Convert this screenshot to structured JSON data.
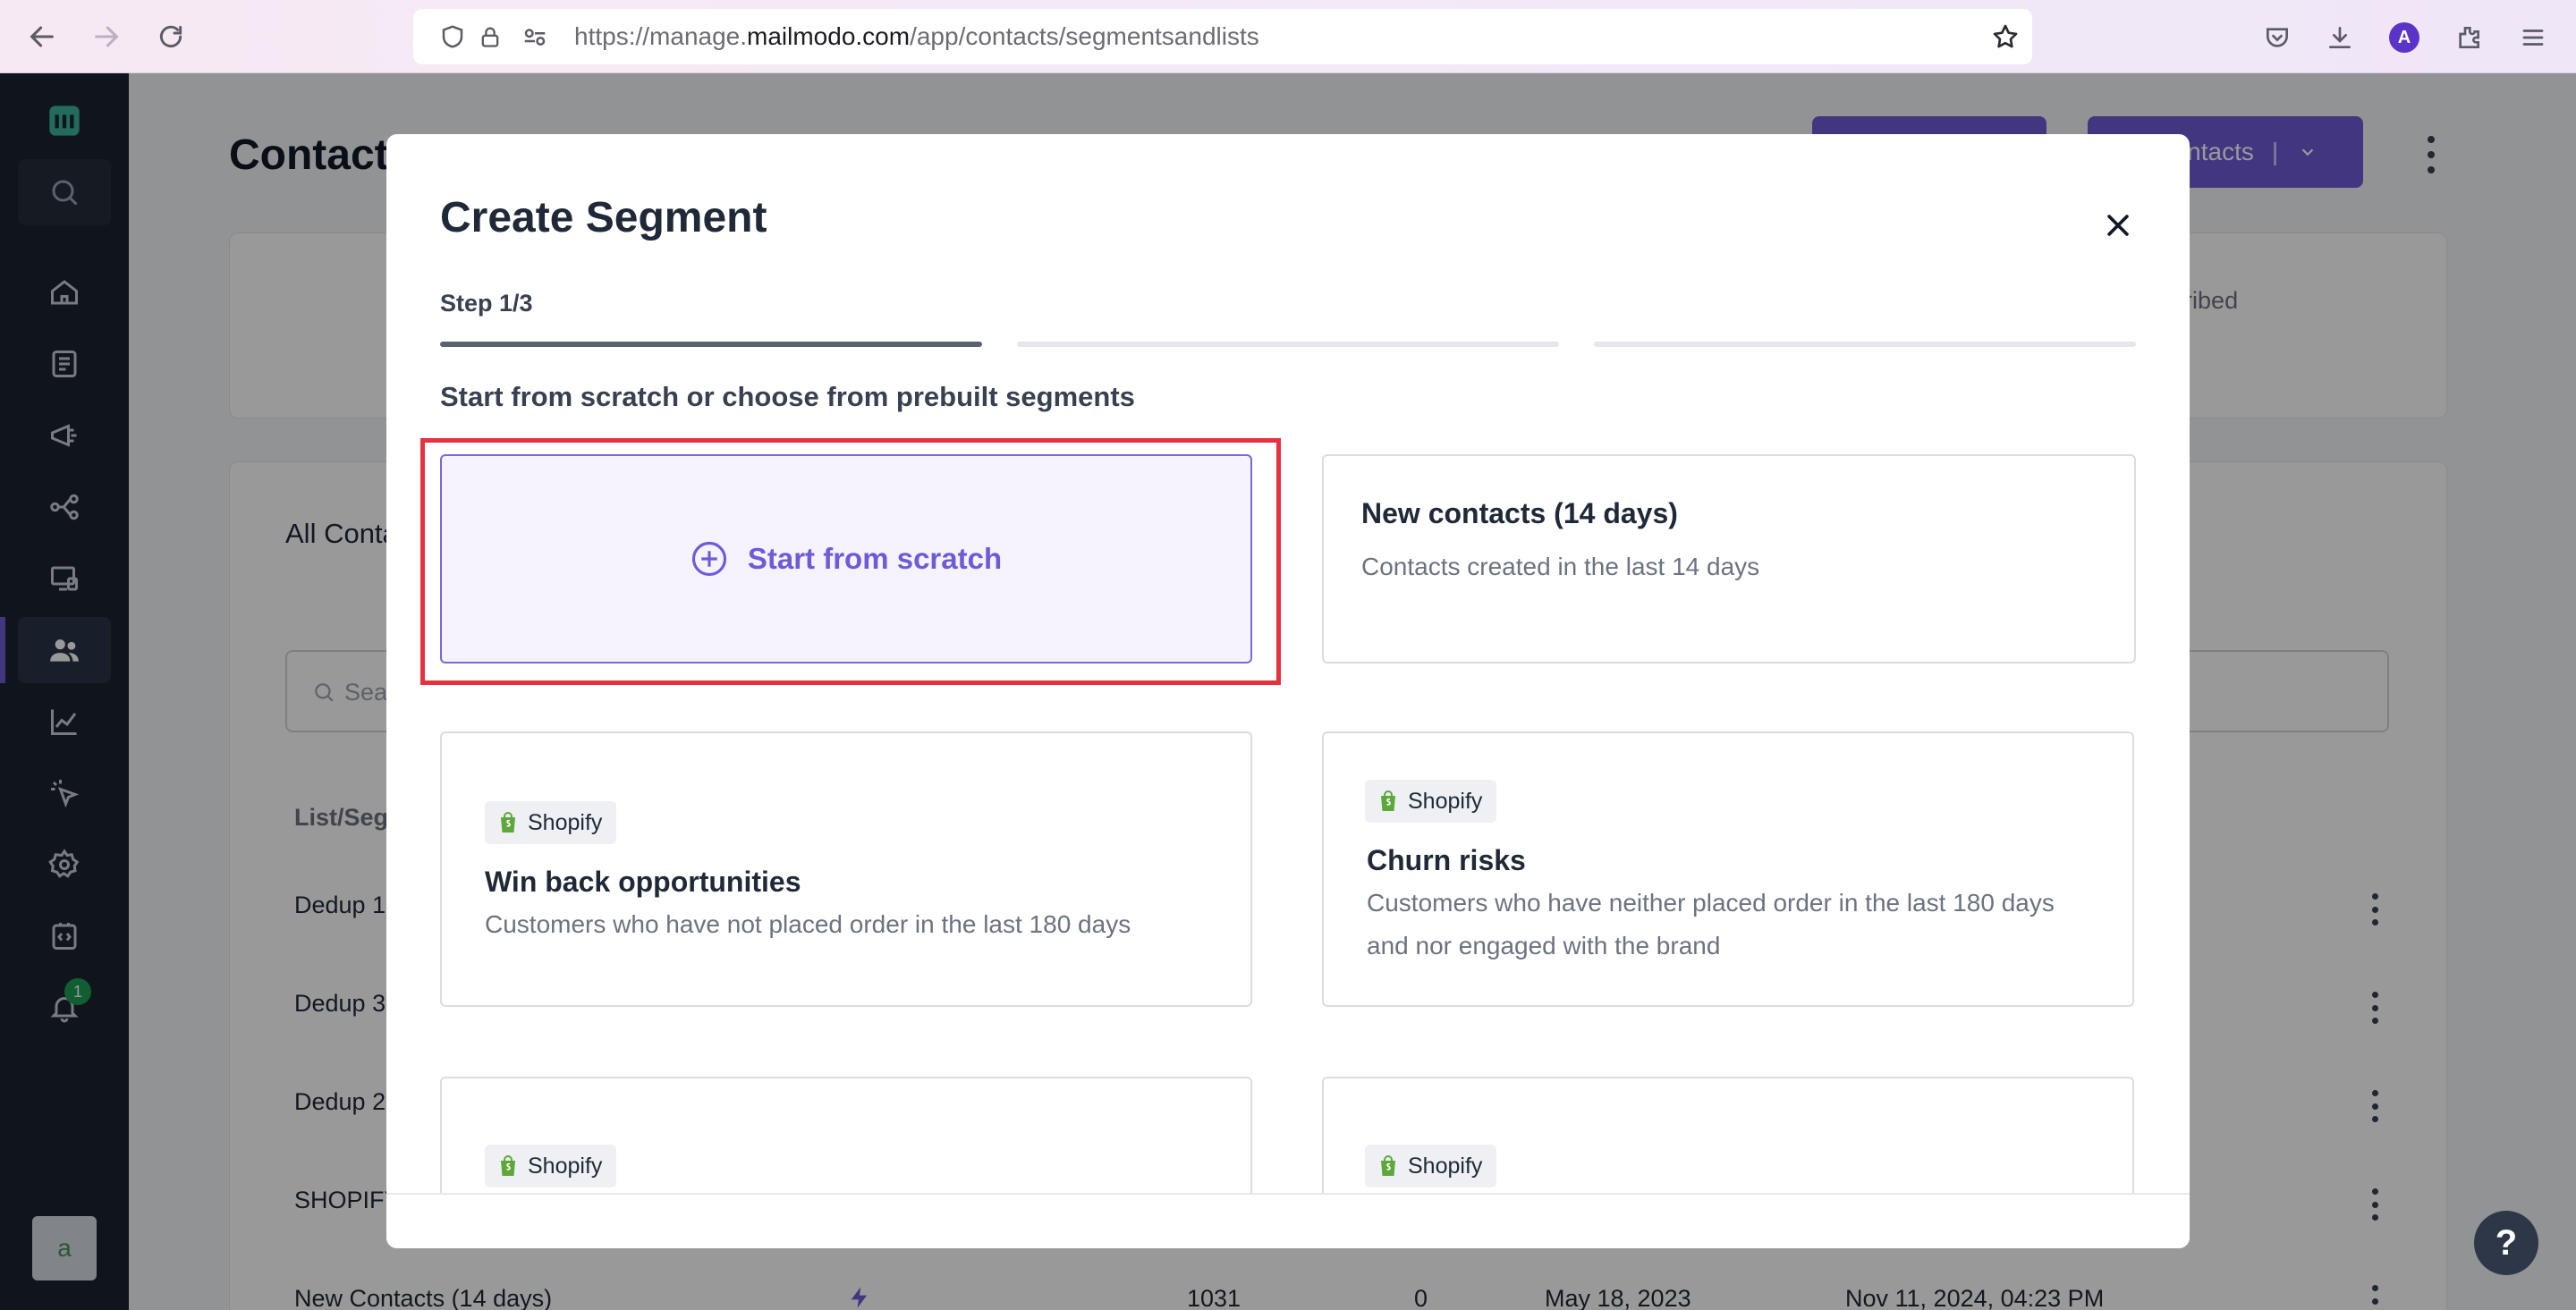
{
  "browser": {
    "url_prefix": "https://manage.",
    "url_domain": "mailmodo.com",
    "url_path": "/app/contacts/segmentsandlists",
    "profile_initial": "A"
  },
  "sidebar": {
    "notification_count": "1",
    "workspace_initial": "a"
  },
  "page": {
    "title": "Contacts",
    "header_button": "Add contacts",
    "stats_fragment": "Unsubscribed",
    "list_heading": "All Contacts",
    "search_placeholder": "Search",
    "column_header": "List/Segment",
    "rows": [
      {
        "name": "Dedup 1"
      },
      {
        "name": "Dedup 3"
      },
      {
        "name": "Dedup 2"
      },
      {
        "name": "SHOPIFY"
      },
      {
        "name": "New Contacts (14 days)",
        "count": "1031",
        "value": "0",
        "created": "May 18, 2023",
        "updated": "Nov 11, 2024, 04:23 PM"
      }
    ]
  },
  "modal": {
    "title": "Create Segment",
    "step": "Step 1/3",
    "subtitle": "Start from scratch or choose from prebuilt segments",
    "scratch_label": "Start from scratch",
    "cards": [
      {
        "title": "New contacts (14 days)",
        "desc": "Contacts created in the last 14 days"
      },
      {
        "badge": "Shopify",
        "title": "Win back opportunities",
        "desc": "Customers who have not placed order in the last 180 days"
      },
      {
        "badge": "Shopify",
        "title": "Churn risks",
        "desc": "Customers who have neither placed order in the last 180 days and nor engaged with the brand"
      },
      {
        "badge": "Shopify"
      },
      {
        "badge": "Shopify"
      }
    ]
  },
  "help": {
    "label": "?"
  }
}
